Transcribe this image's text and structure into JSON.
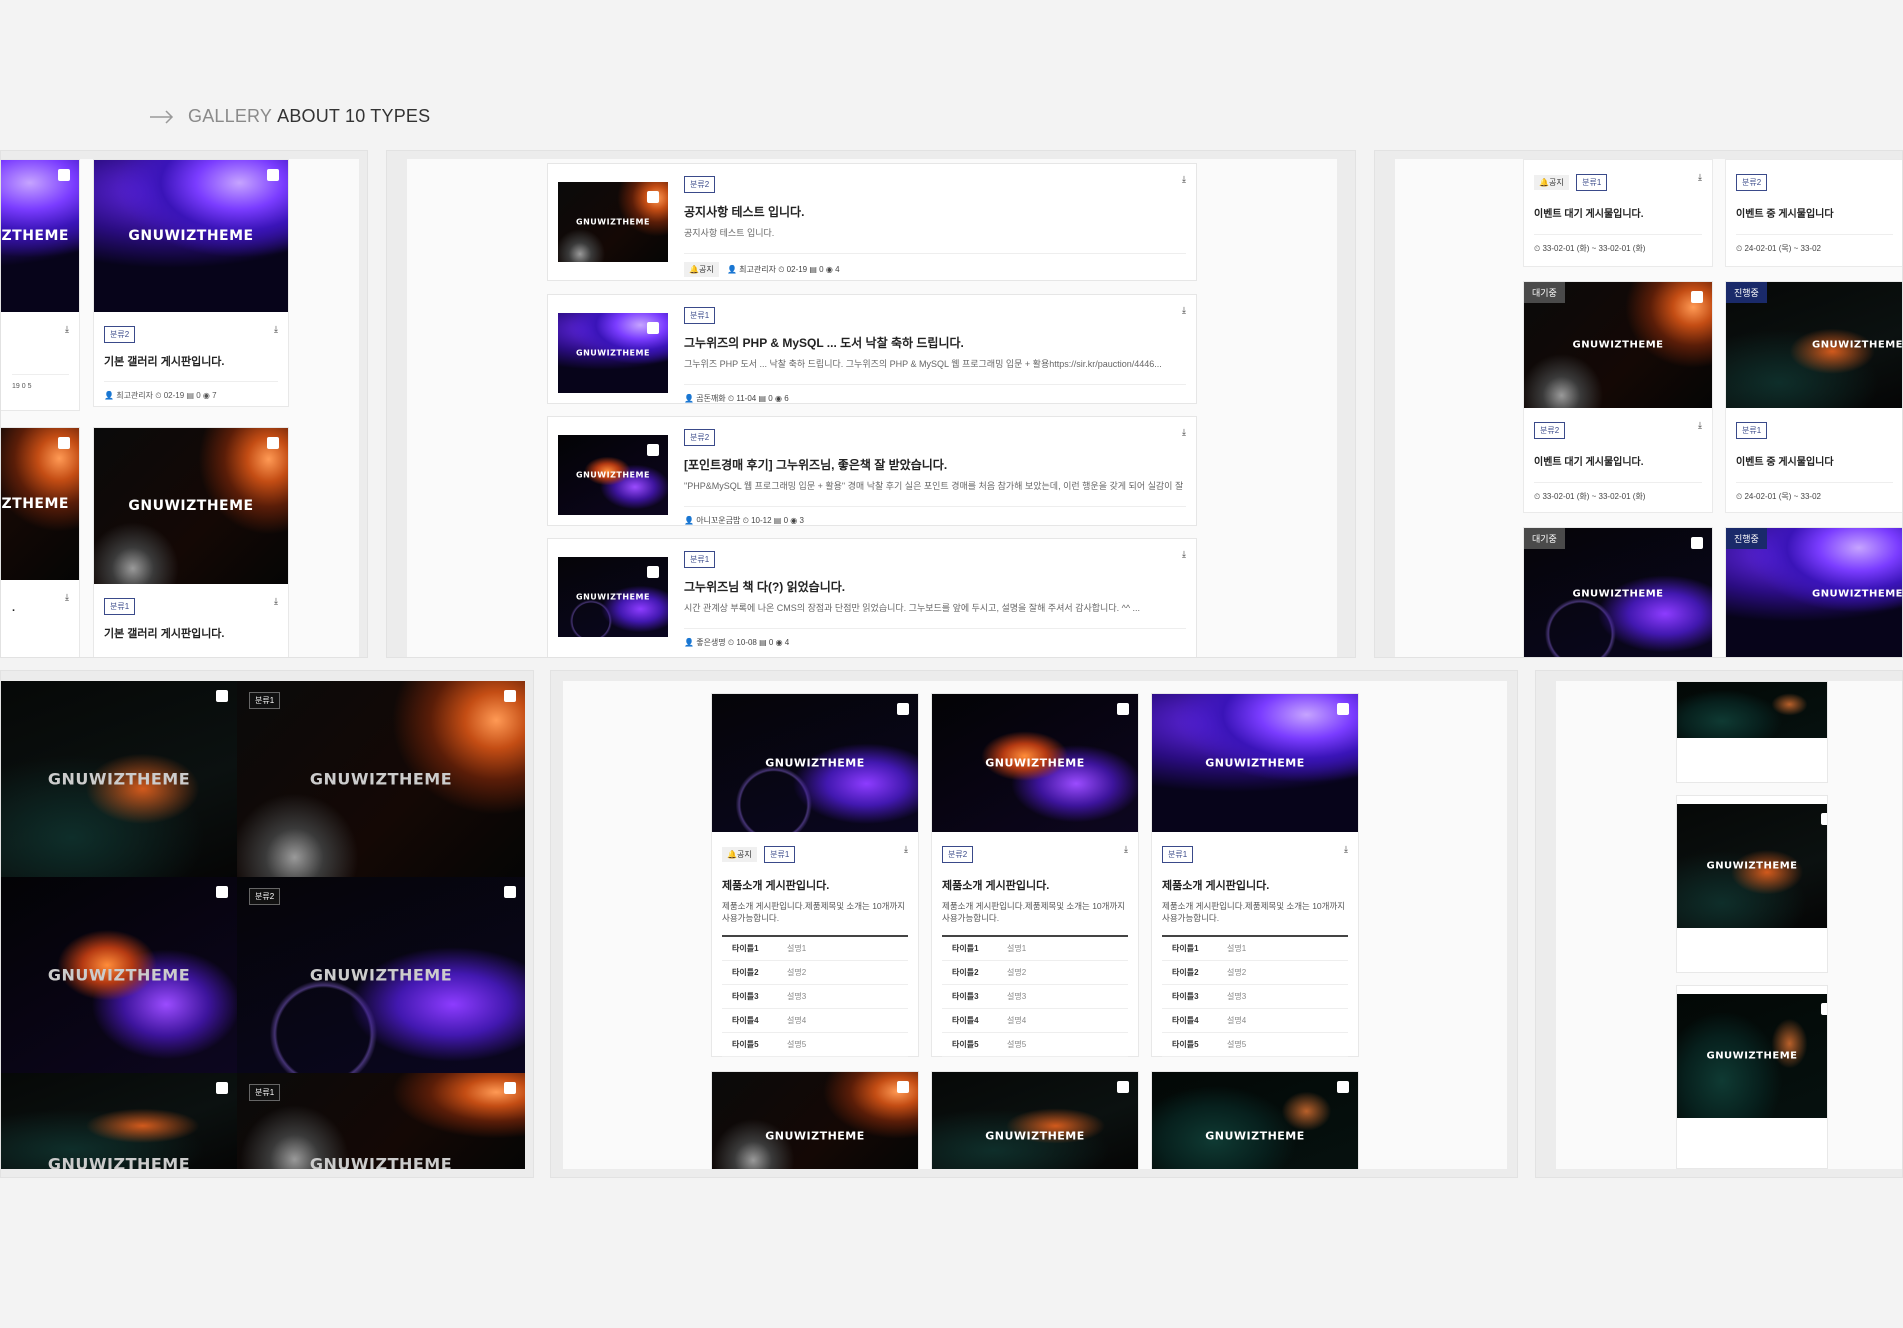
{
  "heading": {
    "muted": "GALLERY",
    "strong": "ABOUT 10 TYPES"
  },
  "watermark": "GNUWIZTHEME",
  "download_icon": "download-icon",
  "gallery": {
    "cards": [
      {
        "category": "분류2",
        "title": "기본 갤러리 게시판입니다.",
        "author": "최고관리자",
        "date": "02-19",
        "comments": "0",
        "views": "7"
      },
      {
        "category": "분류1",
        "title": "기본 갤러리 게시판입니다."
      }
    ],
    "partial_meta": "19  0  5",
    "partial_title": "."
  },
  "list": {
    "rows": [
      {
        "category": "분류2",
        "title": "공지사항 테스트 입니다.",
        "desc": "공지사항 테스트 입니다.",
        "notice": "공지",
        "author": "최고관리자",
        "date": "02-19",
        "comments": "0",
        "views": "4"
      },
      {
        "category": "분류1",
        "title": "그누위즈의 PHP & MySQL ... 도서 낙찰 축하 드립니다.",
        "desc": "그누위즈 PHP 도서 ... 낙찰 축하 드립니다.  그누위즈의 PHP & MySQL 웹 프로그래밍 입문 + 활용https://sir.kr/pauction/4446...",
        "author": "곰돈깨화",
        "date": "11-04",
        "comments": "0",
        "views": "6"
      },
      {
        "category": "분류2",
        "title": "[포인트경매 후기] 그누위즈님, 좋은책 잘 받았습니다.",
        "desc": "\"PHP&MySQL 웹 프로그래밍 입문 + 활용\" 경매 낙찰 후기   실은 포인트 경매를 처음 참가해 보았는데, 이런 행운을 갖게 되어 실감이 잘 안나...",
        "author": "아니꼬운금밥",
        "date": "10-12",
        "comments": "0",
        "views": "3"
      },
      {
        "category": "분류1",
        "title": "그누위즈님 책 다(?) 읽었습니다.",
        "desc": "시간 관계상 부록에 나온 CMS의 장점과 단점만 읽었습니다.  그누보드를 앞에 두시고, 설명을 잘해 주셔서 감사합니다. ^^  ...",
        "author": "좋은생명",
        "date": "10-08",
        "comments": "0",
        "views": "4"
      }
    ]
  },
  "events": {
    "cards": [
      {
        "notice": "공지",
        "category": "분류1",
        "title": "이벤트 대기 게시물입니다.",
        "date": "33-02-01 (화) ~ 33-02-01 (화)"
      },
      {
        "category": "분류2",
        "title": "이벤트 중 게시물입니다",
        "date": "24-02-01 (목) ~ 33-02"
      },
      {
        "state": "대기중",
        "category": "분류2",
        "title": "이벤트 대기 게시물입니다.",
        "date": "33-02-01 (화) ~ 33-02-01 (화)"
      },
      {
        "state": "진행중",
        "category": "분류1",
        "title": "이벤트 중 게시물입니다",
        "date": "24-02-01 (목) ~ 33-02"
      },
      {
        "state": "대기중"
      },
      {
        "state": "진행중"
      }
    ],
    "colors": {
      "waiting": "#4a4a4a",
      "ongoing": "#1a2a6a"
    }
  },
  "mosaic": {
    "tags": [
      "분류1",
      "분류2",
      "분류1"
    ]
  },
  "products": {
    "cards": [
      {
        "notice": "공지",
        "category": "분류1",
        "title": "제품소개 게시판입니다.",
        "desc": "제품소개 게시판입니다.제품제목및 소개는 10개까지 사용가능합니다."
      },
      {
        "category": "분류2",
        "title": "제품소개 게시판입니다.",
        "desc": "제품소개 게시판입니다.제품제목및 소개는 10개까지 사용가능합니다."
      },
      {
        "category": "분류1",
        "title": "제품소개 게시판입니다.",
        "desc": "제품소개 게시판입니다.제품제목및 소개는 10개까지 사용가능합니다."
      }
    ],
    "spec": [
      {
        "k": "타이틀1",
        "v": "설명1"
      },
      {
        "k": "타이틀2",
        "v": "설명2"
      },
      {
        "k": "타이틀3",
        "v": "설명3"
      },
      {
        "k": "타이틀4",
        "v": "설명4"
      },
      {
        "k": "타이틀5",
        "v": "설명5"
      }
    ]
  }
}
